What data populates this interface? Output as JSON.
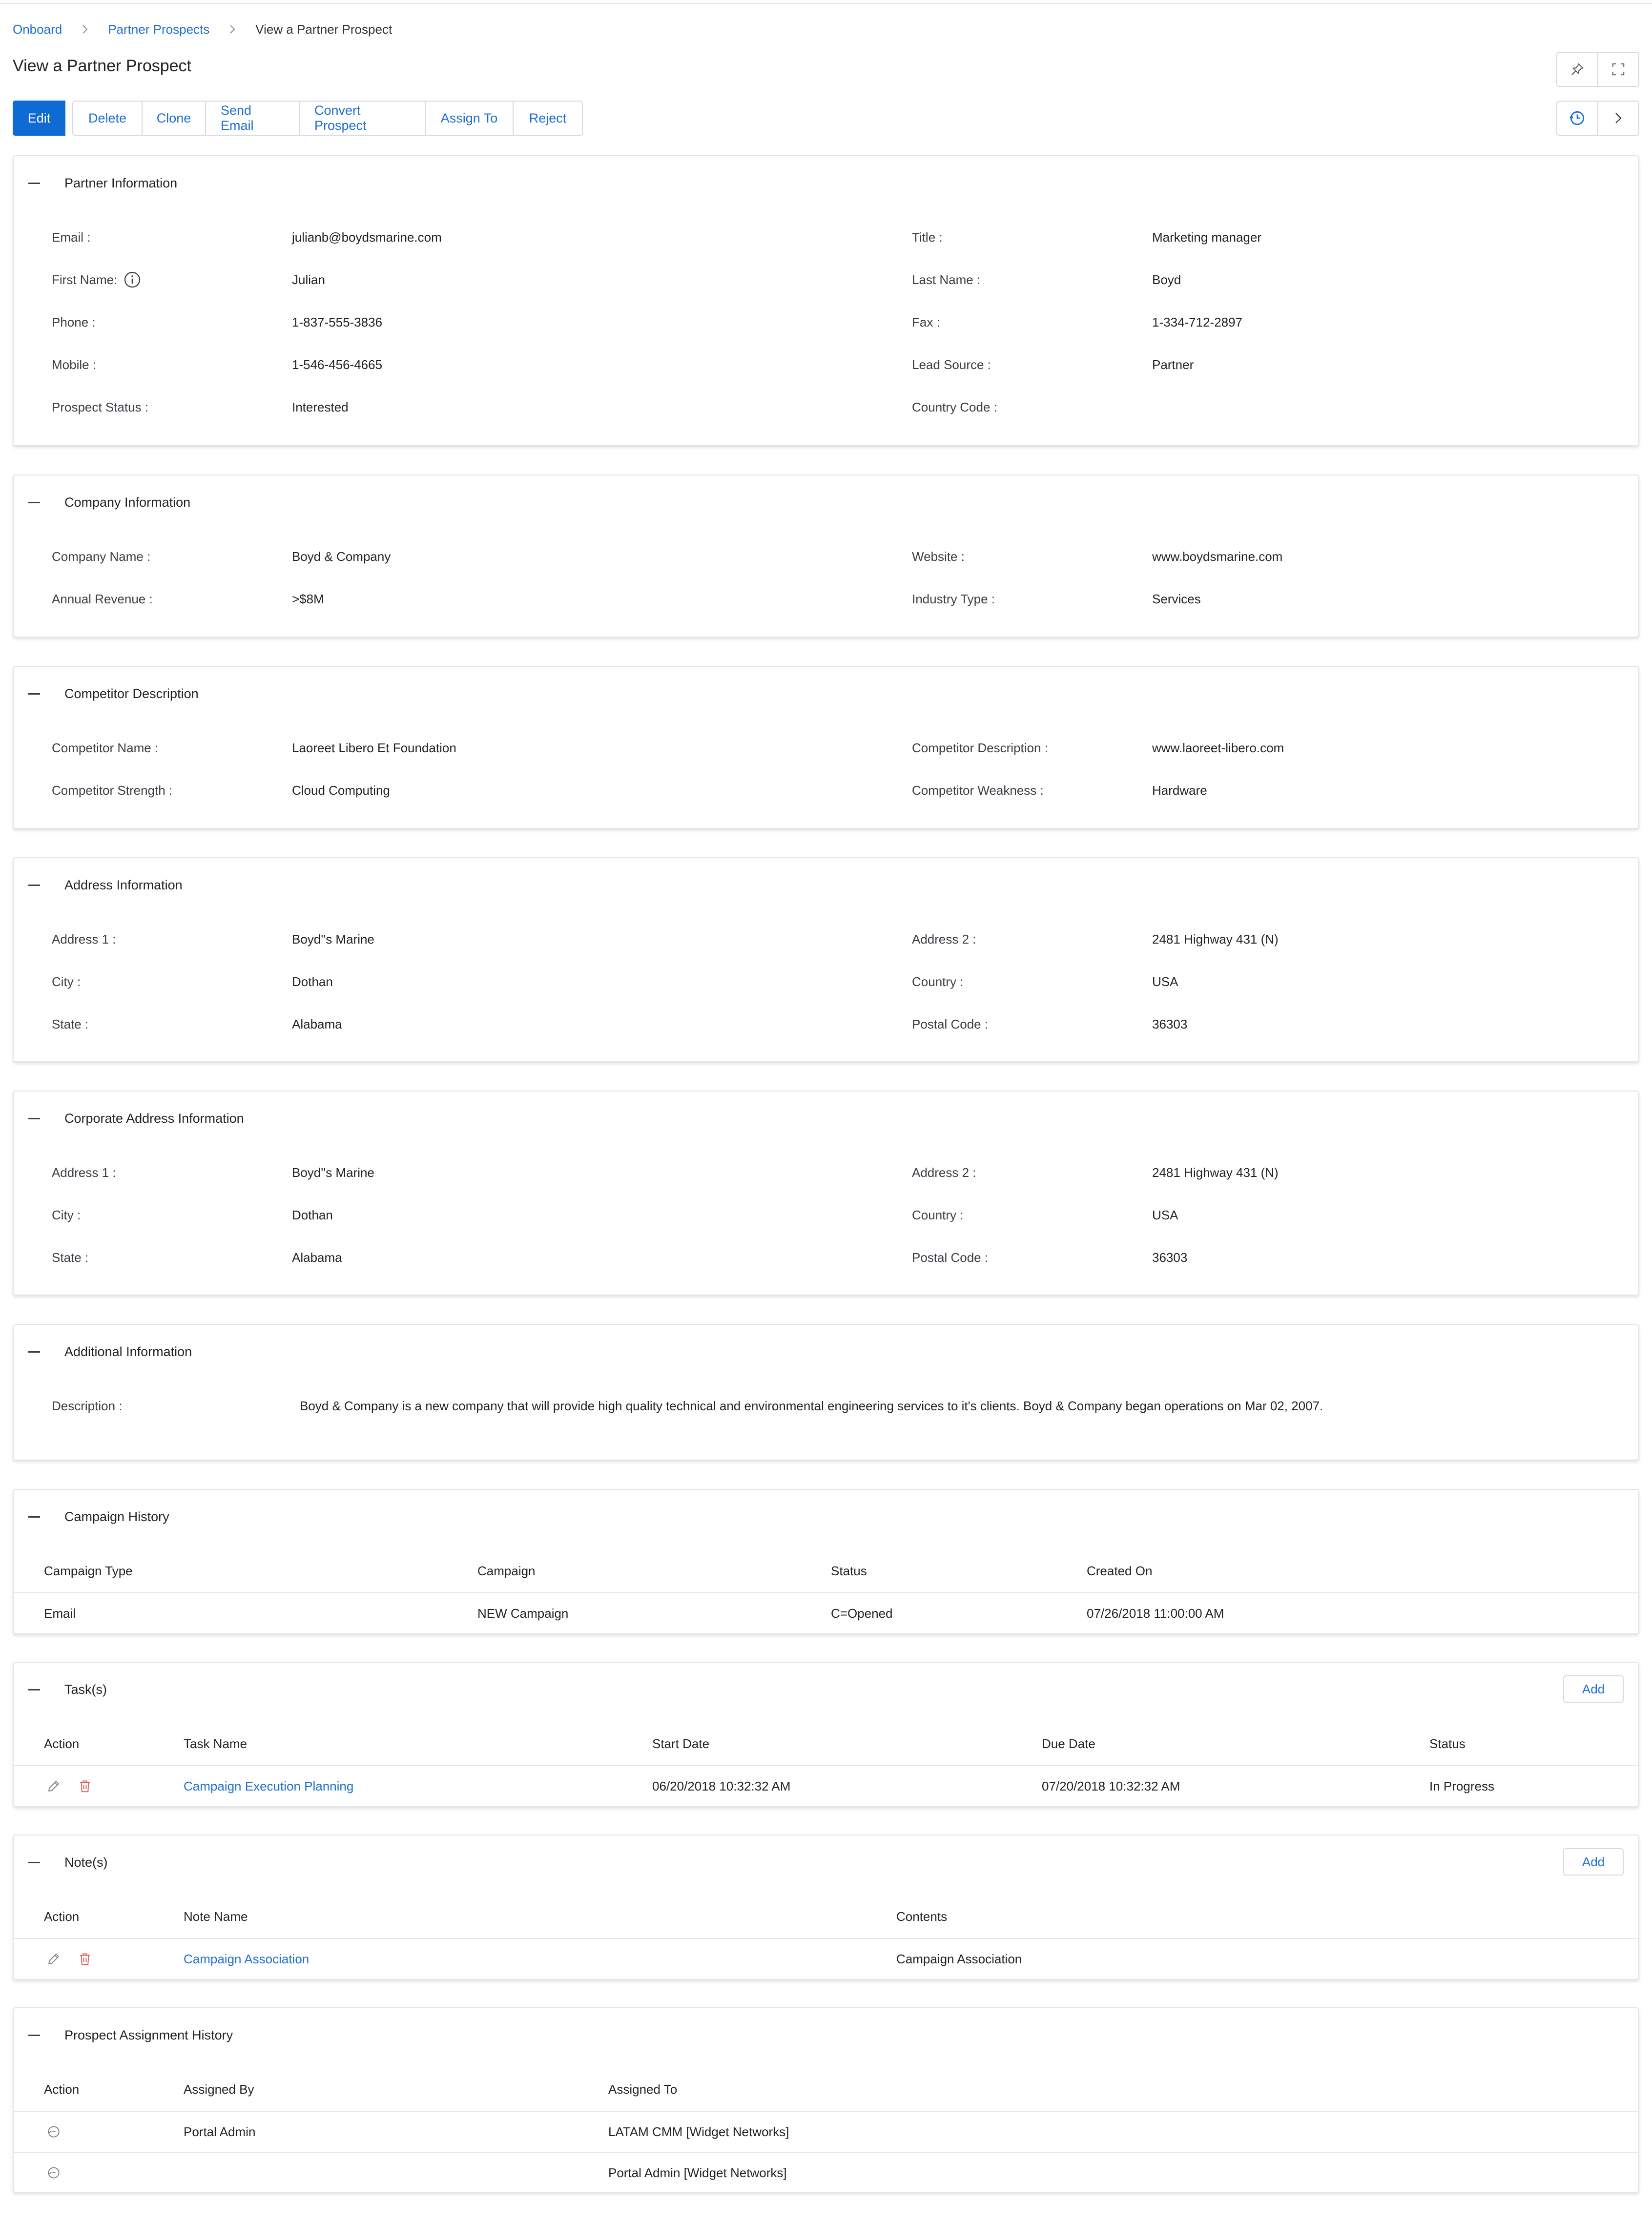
{
  "breadcrumb": {
    "items": [
      "Onboard",
      "Partner Prospects",
      "View a Partner Prospect"
    ]
  },
  "page": {
    "title": "View a Partner Prospect"
  },
  "toolbar": {
    "buttons": [
      "Edit",
      "Delete",
      "Clone",
      "Send Email",
      "Convert Prospect",
      "Assign To",
      "Reject"
    ]
  },
  "header_icons": [
    "pin-icon",
    "expand-icon",
    "history-icon",
    "chevron-right-icon"
  ],
  "partner_info": {
    "title": "Partner Information",
    "fields": [
      {
        "label": "Email :",
        "value": "julianb@boydsmarine.com"
      },
      {
        "label": "Title :",
        "value": "Marketing manager"
      },
      {
        "label": "First Name:",
        "value": "Julian"
      },
      {
        "label": "Last Name :",
        "value": "Boyd"
      },
      {
        "label": "Phone :",
        "value": "1-837-555-3836"
      },
      {
        "label": "Fax :",
        "value": "1-334-712-2897"
      },
      {
        "label": "Mobile :",
        "value": "1-546-456-4665"
      },
      {
        "label": "Lead Source :",
        "value": "Partner"
      },
      {
        "label": "Prospect Status :",
        "value": "Interested"
      },
      {
        "label": "Country Code :",
        "value": ""
      }
    ]
  },
  "company_info": {
    "title": "Company Information",
    "fields": [
      {
        "label": "Company Name :",
        "value": "Boyd & Company"
      },
      {
        "label": "Website :",
        "value": "www.boydsmarine.com"
      },
      {
        "label": "Annual Revenue :",
        "value": ">$8M"
      },
      {
        "label": "Industry Type :",
        "value": "Services"
      }
    ]
  },
  "competitor": {
    "title": "Competitor Description",
    "fields": [
      {
        "label": "Competitor Name :",
        "value": "Laoreet Libero Et Foundation"
      },
      {
        "label": "Competitor Description :",
        "value": "www.laoreet-libero.com"
      },
      {
        "label": "Competitor Strength :",
        "value": "Cloud Computing"
      },
      {
        "label": "Competitor Weakness :",
        "value": "Hardware"
      }
    ]
  },
  "address": {
    "title": "Address Information",
    "fields": [
      {
        "label": "Address 1 :",
        "value": "Boyd''s Marine"
      },
      {
        "label": "Address 2 :",
        "value": "2481 Highway 431 (N)"
      },
      {
        "label": "City :",
        "value": "Dothan"
      },
      {
        "label": "Country :",
        "value": "USA"
      },
      {
        "label": "State :",
        "value": "Alabama"
      },
      {
        "label": "Postal Code :",
        "value": "36303"
      }
    ]
  },
  "corporate_address": {
    "title": "Corporate Address Information",
    "fields": [
      {
        "label": "Address 1 :",
        "value": "Boyd''s Marine"
      },
      {
        "label": "Address 2 :",
        "value": "2481 Highway 431 (N)"
      },
      {
        "label": "City :",
        "value": "Dothan"
      },
      {
        "label": "Country :",
        "value": "USA"
      },
      {
        "label": "State :",
        "value": "Alabama"
      },
      {
        "label": "Postal Code :",
        "value": "36303"
      }
    ]
  },
  "additional": {
    "title": "Additional Information",
    "label": "Description :",
    "value": "Boyd & Company is a new company that will provide high quality technical and environmental engineering services to it's clients. Boyd & Company began operations on Mar 02, 2007."
  },
  "campaign_history": {
    "title": "Campaign History",
    "columns": [
      "Campaign Type",
      "Campaign",
      "Status",
      "Created On"
    ],
    "rows": [
      [
        "Email",
        "NEW Campaign",
        "C=Opened",
        "07/26/2018 11:00:00 AM"
      ]
    ]
  },
  "tasks": {
    "title": "Task(s)",
    "add_label": "Add",
    "columns": [
      "Action",
      "Task Name",
      "Start Date",
      "Due Date",
      "Status"
    ],
    "rows": [
      [
        "Campaign Execution Planning",
        "06/20/2018 10:32:32 AM",
        "07/20/2018 10:32:32 AM",
        "In Progress"
      ]
    ]
  },
  "notes": {
    "title": "Note(s)",
    "add_label": "Add",
    "columns": [
      "Action",
      "Note Name",
      "Contents"
    ],
    "rows": [
      [
        "Campaign Association",
        "Campaign Association"
      ]
    ]
  },
  "assignment_history": {
    "title": "Prospect Assignment History",
    "columns": [
      "Action",
      "Assigned By",
      "Assigned To"
    ],
    "rows": [
      [
        "Portal Admin",
        "LATAM CMM [Widget Networks]"
      ],
      [
        "",
        "Portal Admin [Widget Networks]"
      ]
    ]
  },
  "colors": {
    "accent": "#1f6fd1",
    "primary_button": "#0f6ad3",
    "delete_icon": "#e05a5a"
  }
}
